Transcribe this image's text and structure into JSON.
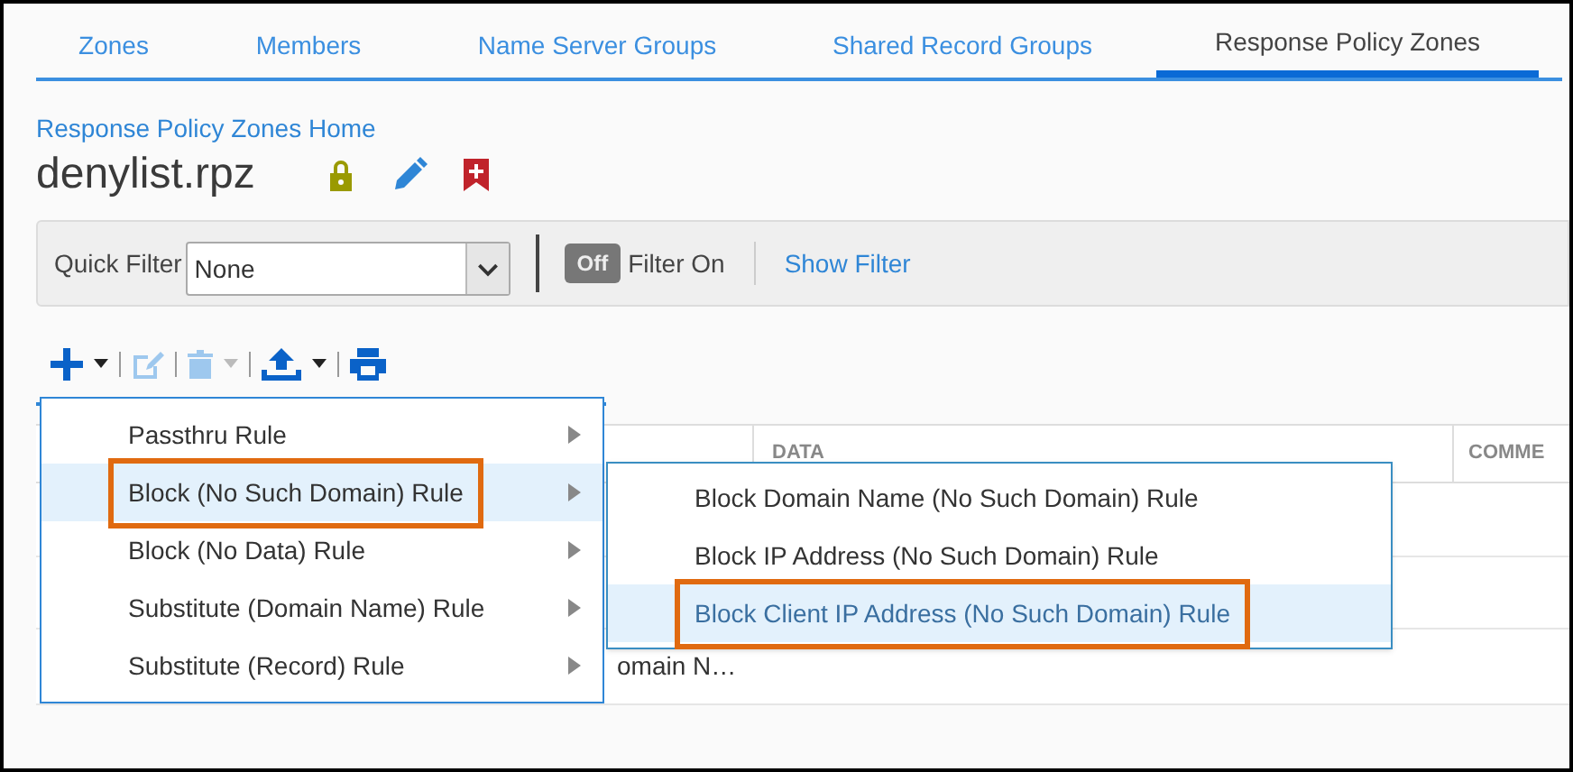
{
  "tabs": [
    {
      "label": "Zones",
      "selected": false
    },
    {
      "label": "Members",
      "selected": false
    },
    {
      "label": "Name Server Groups",
      "selected": false
    },
    {
      "label": "Shared Record Groups",
      "selected": false
    },
    {
      "label": "Response Policy Zones",
      "selected": true
    }
  ],
  "breadcrumb": "Response Policy Zones Home",
  "title": "denylist.rpz",
  "filter_bar": {
    "label": "Quick Filter",
    "value": "None",
    "toggle": {
      "label": "Off",
      "on": false
    },
    "toggle_label": "Filter On",
    "link": "Show Filter"
  },
  "table": {
    "columns": [
      "DATA",
      "COMME"
    ],
    "rows": [
      {
        "cells": [
          "omain N…"
        ]
      }
    ]
  },
  "menu": {
    "items": [
      {
        "label": "Passthru Rule",
        "selected": false,
        "highlighted": false
      },
      {
        "label": "Block (No Such Domain) Rule",
        "selected": true,
        "highlighted": true
      },
      {
        "label": "Block (No Data) Rule",
        "selected": false,
        "highlighted": false
      },
      {
        "label": "Substitute (Domain Name) Rule",
        "selected": false,
        "highlighted": false
      },
      {
        "label": "Substitute (Record) Rule",
        "selected": false,
        "highlighted": false
      }
    ]
  },
  "submenu": {
    "items": [
      {
        "label": "Block Domain Name (No Such Domain) Rule",
        "selected": false,
        "highlighted": false
      },
      {
        "label": "Block IP Address (No Such Domain) Rule",
        "selected": false,
        "highlighted": false
      },
      {
        "label": "Block Client IP Address (No Such Domain) Rule",
        "selected": true,
        "highlighted": true
      }
    ]
  }
}
